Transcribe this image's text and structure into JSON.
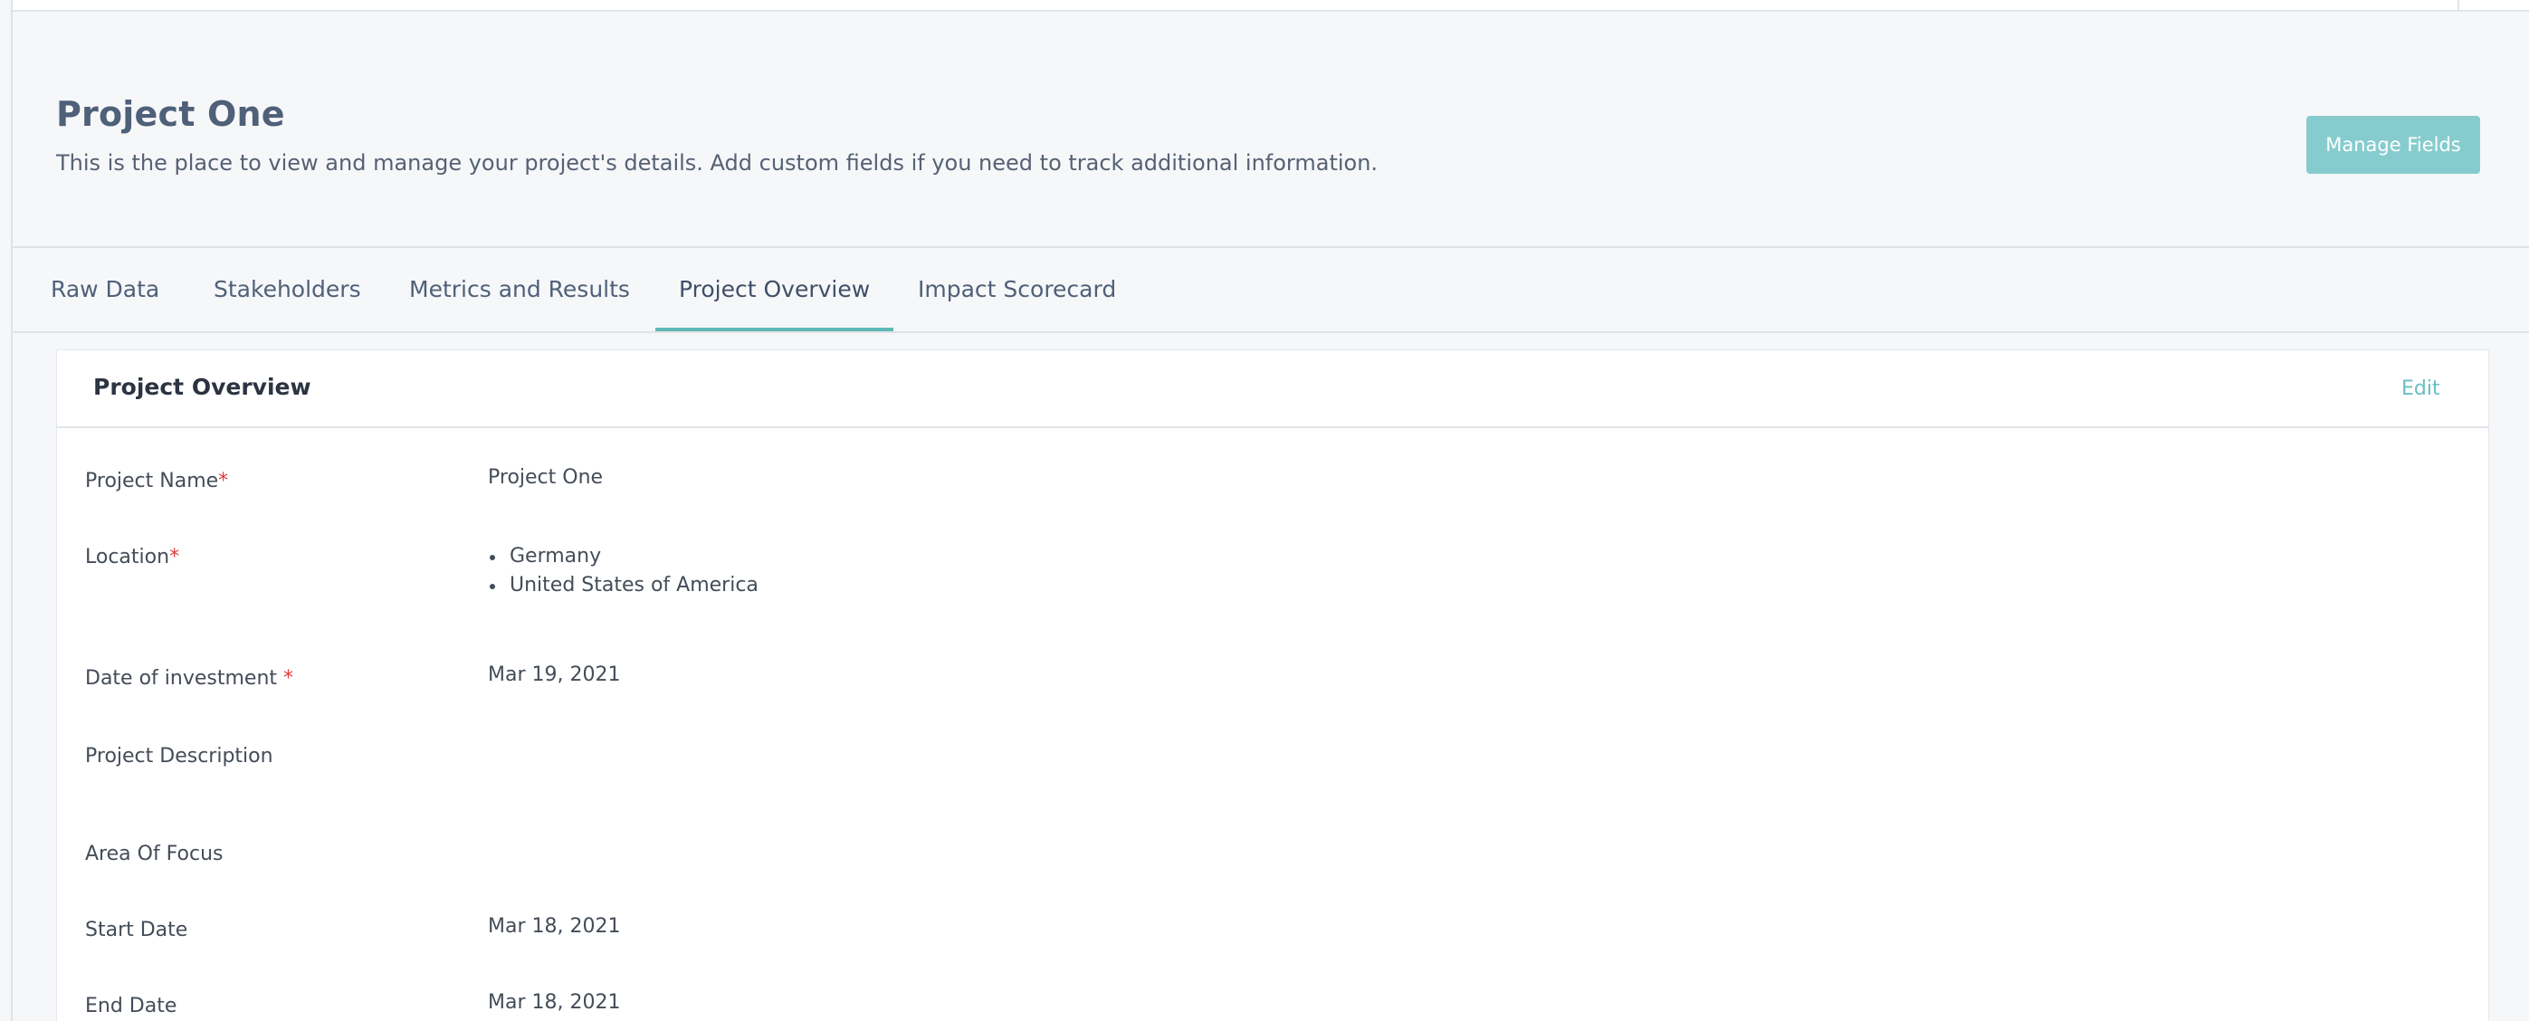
{
  "header": {
    "title": "Project One",
    "subtitle": "This is the place to view and manage your project's details. Add custom fields if you need to track additional information.",
    "manage_fields_label": "Manage Fields"
  },
  "tabs": [
    {
      "label": "Raw Data",
      "active": false
    },
    {
      "label": "Stakeholders",
      "active": false
    },
    {
      "label": "Metrics and Results",
      "active": false
    },
    {
      "label": "Project Overview",
      "active": true
    },
    {
      "label": "Impact Scorecard",
      "active": false
    }
  ],
  "card": {
    "title": "Project Overview",
    "edit_label": "Edit",
    "required_marker": "*",
    "fields": {
      "project_name": {
        "label": "Project Name",
        "value": "Project One"
      },
      "location": {
        "label": "Location",
        "values": [
          "Germany",
          "United States of America"
        ]
      },
      "date_of_investment": {
        "label": "Date of investment ",
        "value": "Mar 19, 2021"
      },
      "project_description": {
        "label": "Project Description",
        "value": ""
      },
      "area_of_focus": {
        "label": "Area Of Focus",
        "value": ""
      },
      "start_date": {
        "label": "Start Date",
        "value": "Mar 18, 2021"
      },
      "end_date": {
        "label": "End Date",
        "value": "Mar 18, 2021"
      }
    }
  },
  "colors": {
    "accent": "#5fb9b7",
    "button": "#86ccce",
    "required": "#e03b3b",
    "title": "#4f6079"
  }
}
